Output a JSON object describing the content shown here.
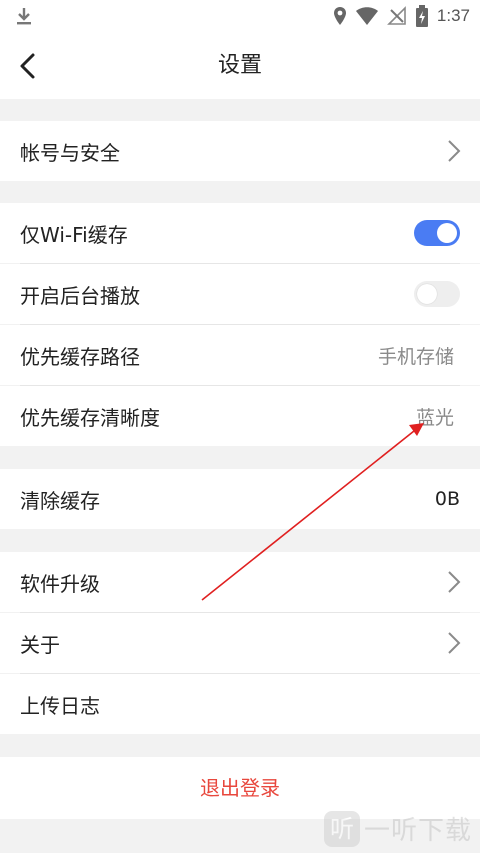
{
  "status_bar": {
    "time": "1:37",
    "icons": [
      "download-icon",
      "location-icon",
      "wifi-icon",
      "no-signal-icon",
      "battery-icon"
    ]
  },
  "header": {
    "title": "设置"
  },
  "sections": {
    "account": {
      "label": "帐号与安全"
    },
    "wifi_cache": {
      "label": "仅Wi-Fi缓存",
      "enabled": true
    },
    "background_play": {
      "label": "开启后台播放",
      "enabled": false
    },
    "cache_path": {
      "label": "优先缓存路径",
      "value": "手机存储"
    },
    "cache_quality": {
      "label": "优先缓存清晰度",
      "value": "蓝光"
    },
    "clear_cache": {
      "label": "清除缓存",
      "value": "0B"
    },
    "upgrade": {
      "label": "软件升级"
    },
    "about": {
      "label": "关于"
    },
    "upload_log": {
      "label": "上传日志"
    }
  },
  "logout": {
    "label": "退出登录"
  },
  "watermark": {
    "icon_text": "听",
    "text": "一听下载"
  },
  "colors": {
    "accent": "#4a7cf3",
    "logout": "#e8473d",
    "annotation_arrow": "#e02020"
  }
}
